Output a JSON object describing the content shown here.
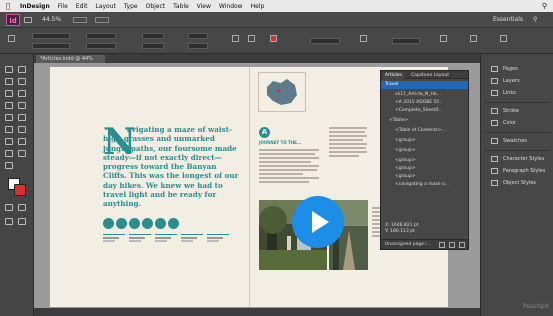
{
  "menubar": {
    "items": [
      "InDesign",
      "File",
      "Edit",
      "Layout",
      "Type",
      "Object",
      "Table",
      "View",
      "Window",
      "Help"
    ]
  },
  "appbar": {
    "logo": "Id",
    "zoom": "44.5%",
    "workspace": "Essentials"
  },
  "document": {
    "tab": "*Articles.indd @ 44%"
  },
  "headline": {
    "dropcap": "N",
    "text": "avigating a maze of waist-high grasses and unmarked jungle paths, our foursome made steady—if not exactly direct—progress toward the Banyan Cliffs. This was the longest of our day hikes. We knew we had to travel light and be ready for anything."
  },
  "journey": {
    "icon": "A",
    "subhead": "JOURNEY TO THE..."
  },
  "articles_panel": {
    "tabs": [
      "Articles",
      "Capstone Layout"
    ],
    "rows": [
      "Travel",
      "xk11_Article_N_Ho...",
      "<A 2015 ADOBE SY...",
      "<Complete_Sheet0...",
      "<Table>",
      "<Table of Contents>...",
      "<group>",
      "<group>",
      "<group>",
      "<group>",
      "<group>",
      "<navigating a maze o..."
    ],
    "selected_index": 0,
    "coords": [
      "X: 1648.821 pt",
      "Y: 180.113 pt"
    ],
    "footer": "Unassigned page i..."
  },
  "right_panel": {
    "items": [
      "Pages",
      "Layers",
      "Links",
      "Stroke",
      "Color",
      "Swatches",
      "Character Styles",
      "Paragraph Styles",
      "Object Styles"
    ]
  },
  "watermark": "Peachpit"
}
